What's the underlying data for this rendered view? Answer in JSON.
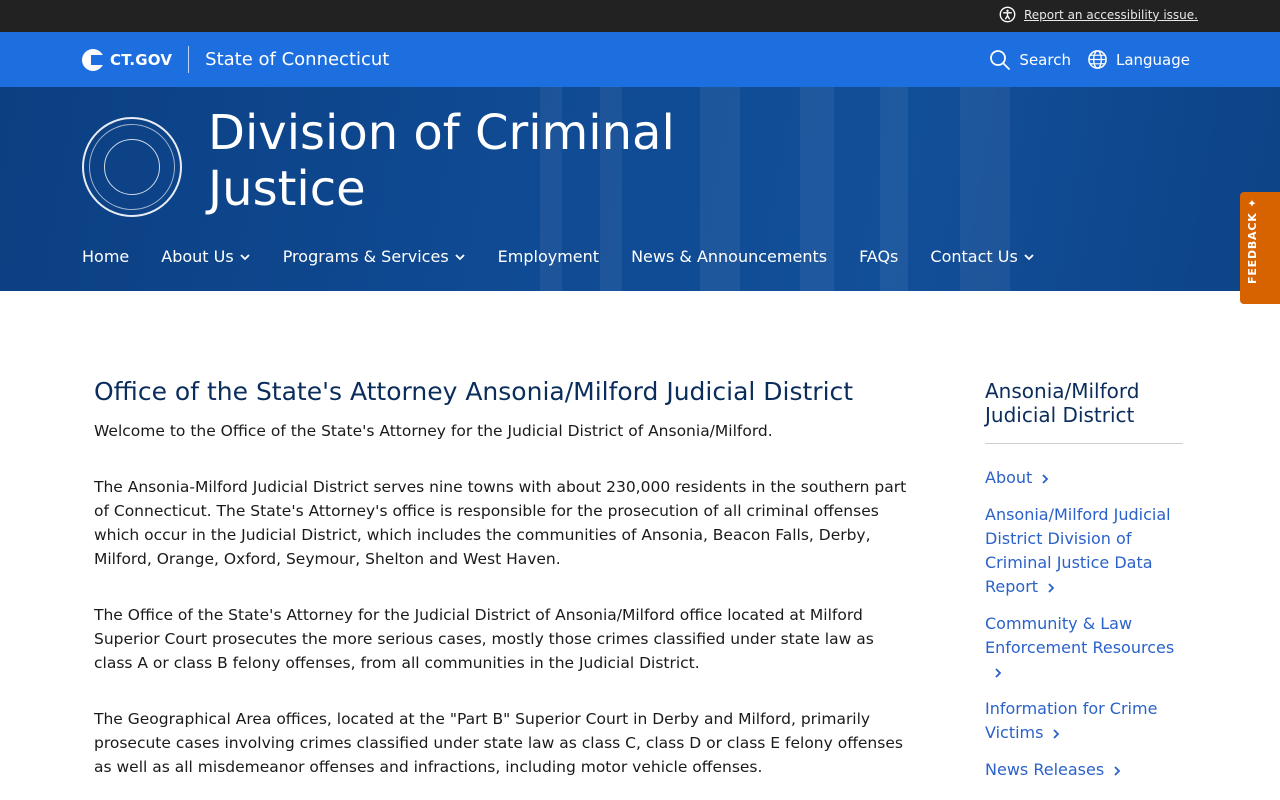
{
  "topbar": {
    "a11y_link": "Report an accessibility issue."
  },
  "ctbar": {
    "logo_text": "CT.GOV",
    "state_name": "State of Connecticut",
    "search_label": "Search",
    "language_label": "Language"
  },
  "hero": {
    "title": "Division of Criminal Justice",
    "nav": [
      {
        "label": "Home"
      },
      {
        "label": "About Us"
      },
      {
        "label": "Programs & Services"
      },
      {
        "label": "Employment"
      },
      {
        "label": "News & Announcements"
      },
      {
        "label": "FAQs"
      },
      {
        "label": "Contact Us"
      }
    ]
  },
  "feedback": {
    "label": "FEEDBACK"
  },
  "main": {
    "title": "Office of the State's Attorney Ansonia/Milford Judicial District",
    "paragraphs": [
      "Welcome to the Office of the State's Attorney for the Judicial District of Ansonia/Milford.",
      "The Ansonia-Milford Judicial District serves nine towns with about 230,000 residents in the southern part of Connecticut. The State's Attorney's office is responsible for the prosecution of all criminal offenses which occur in the Judicial District, which includes the communities of Ansonia, Beacon Falls, Derby, Milford, Orange, Oxford, Seymour, Shelton and West Haven.",
      "The Office of the State's Attorney for the Judicial District of Ansonia/Milford office located at Milford Superior Court prosecutes the more serious cases, mostly those crimes classified under state law as class A or class B felony offenses, from all communities in the Judicial District.",
      "The Geographical Area offices, located at the \"Part B\" Superior Court in Derby and Milford, primarily prosecute cases involving crimes classified under state law as class C, class D or class E felony offenses as well as all misdemeanor offenses and infractions, including motor vehicle offenses."
    ]
  },
  "sidebar": {
    "title": "Ansonia/Milford Judicial District",
    "links": [
      {
        "label": "About"
      },
      {
        "label": "Ansonia/Milford Judicial District Division of Criminal Justice Data Report"
      },
      {
        "label": "Community & Law Enforcement Resources"
      },
      {
        "label": "Information for Crime Victims"
      },
      {
        "label": "News Releases"
      }
    ]
  }
}
